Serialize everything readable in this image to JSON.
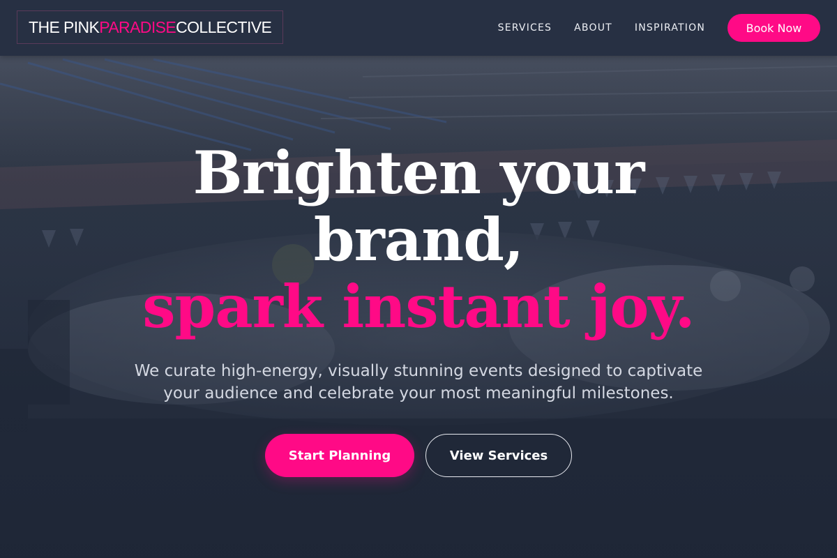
{
  "header": {
    "logo": {
      "part1": "THE PINK ",
      "accent": "PARADISE",
      "part2": " COLLECTIVE"
    },
    "nav": [
      "SERVICES",
      "ABOUT",
      "INSPIRATION"
    ],
    "book_label": "Book Now"
  },
  "hero": {
    "headline_line1": "Brighten your",
    "headline_line2": "brand,",
    "headline_line3": "spark instant joy.",
    "subtext": "We curate high-energy, visually stunning events designed to captivate your audience and celebrate your most meaningful milestones.",
    "primary_cta": "Start Planning",
    "secondary_cta": "View Services"
  },
  "colors": {
    "accent": "#ff0a86",
    "header_bg": "#273043",
    "hero_bg": "#1f2738",
    "text": "#ffffff"
  }
}
